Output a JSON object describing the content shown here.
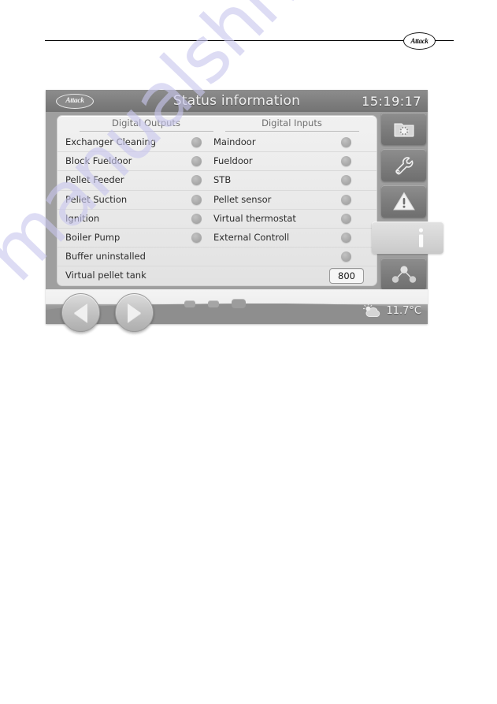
{
  "page_header": {
    "logo_text": "Attack"
  },
  "watermark": {
    "text": "manualshive.com"
  },
  "device": {
    "titlebar": {
      "logo_text": "Attack",
      "title": "Status information",
      "clock": "15:19:17"
    },
    "panel": {
      "column_headers": {
        "left": "Digital Outputs",
        "right": "Digital Inputs"
      },
      "rows": [
        {
          "left_label": "Exchanger Cleaning",
          "left_indicator": "off",
          "right_label": "Maindoor",
          "right_indicator": "off"
        },
        {
          "left_label": "Block Fueldoor",
          "left_indicator": "off",
          "right_label": "Fueldoor",
          "right_indicator": "off"
        },
        {
          "left_label": "Pellet Feeder",
          "left_indicator": "off",
          "right_label": "STB",
          "right_indicator": "off"
        },
        {
          "left_label": "Pellet Suction",
          "left_indicator": "off",
          "right_label": "Pellet sensor",
          "right_indicator": "off"
        },
        {
          "left_label": "Ignition",
          "left_indicator": "off",
          "right_label": "Virtual thermostat",
          "right_indicator": "off"
        },
        {
          "left_label": "Boiler Pump",
          "left_indicator": "off",
          "right_label": "External Controll",
          "right_indicator": "off"
        },
        {
          "left_label": "Buffer uninstalled",
          "left_indicator": "none",
          "right_label": "",
          "right_indicator": "off"
        },
        {
          "left_label": "Virtual pellet tank",
          "left_indicator": "none",
          "right_label": "",
          "right_indicator": "none",
          "value": "800"
        }
      ]
    },
    "sidebar": {
      "buttons": [
        {
          "name": "settings-folder-gear-icon",
          "selected": false
        },
        {
          "name": "wrench-service-icon",
          "selected": false
        },
        {
          "name": "warning-triangle-icon",
          "selected": false
        },
        {
          "name": "info-icon",
          "selected": true
        },
        {
          "name": "network-nodes-icon",
          "selected": false
        }
      ],
      "info_glyph": "i"
    },
    "navbar": {
      "back_label": "",
      "forward_label": "",
      "page_indicators": 3,
      "active_page_index": 2,
      "weather_icon": "sun-behind-cloud-icon",
      "temperature": "11.7°C"
    }
  },
  "colors": {
    "titlebar": "#7e7e7e",
    "panel_bg": "#ebebeb",
    "indicator_off": "#ababab",
    "accent_text": "#efefef",
    "watermark": "#c9c7ee"
  }
}
